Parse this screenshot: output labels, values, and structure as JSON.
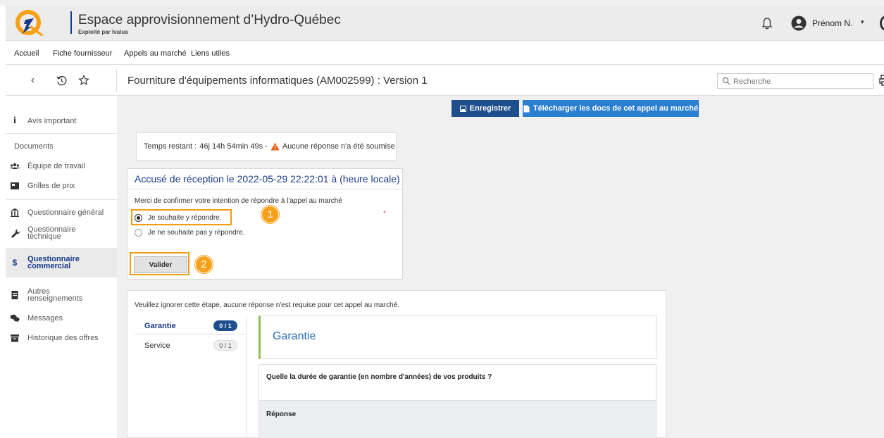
{
  "header": {
    "title": "Espace approvisionnement d’Hydro-Québec",
    "subtitle": "Exploité par Ivalua",
    "user_name": "Prénom N.",
    "caret": "▾"
  },
  "menu": {
    "items": [
      "Accueil",
      "Fiche fournisseur",
      "Appels au marché",
      "Liens utiles"
    ]
  },
  "titlebar": {
    "page_title": "Fourniture d'équipements informatiques (AM002599) : Version 1",
    "search_placeholder": "Recherche"
  },
  "sidebar": {
    "items": [
      {
        "label": "Avis important",
        "icon": "info-icon"
      },
      {
        "label": "Documents",
        "icon": ""
      },
      {
        "label": "Équipe de travail",
        "icon": "team-icon"
      },
      {
        "label": "Grilles de prix",
        "icon": "price-grid-icon"
      },
      {
        "label": "Questionnaire général",
        "icon": "institution-icon"
      },
      {
        "label": "Questionnaire technique",
        "icon": "wrench-icon"
      },
      {
        "label": "Questionnaire commercial",
        "icon": "dollar-icon"
      },
      {
        "label": "Autres renseignements",
        "icon": "document-icon"
      },
      {
        "label": "Messages",
        "icon": "chat-icon"
      },
      {
        "label": "Historique des offres",
        "icon": "archive-icon"
      }
    ],
    "commercial_line1": "Questionnaire",
    "commercial_line2": "commercial",
    "technique_line1": "Questionnaire",
    "technique_line2": "technique",
    "autres_line1": "Autres",
    "autres_line2": "renseignements"
  },
  "toolbar": {
    "save_label": "Enregistrer",
    "download_label": "Télécharger les docs de cet appel au marché"
  },
  "status": {
    "time_label": "Temps restant :",
    "time_value": "46j 14h 54min 49s -",
    "warning_text": "Aucune réponse n'a été soumise"
  },
  "ack": {
    "header": "Accusé de réception le 2022-05-29 22:22:01 à (heure locale)",
    "prompt": "Merci de confirmer votre intention de répondre à l'appel au marché",
    "required": "*",
    "option_yes": "Je souhaite y répondre.",
    "option_no": "Je ne souhaite pas y répondre.",
    "validate_label": "Valider",
    "callout_1": "1",
    "callout_2": "2"
  },
  "questionnaire": {
    "note": "Veuillez ignorer cette étape, aucune réponse n'est requise pour cet appel au marché.",
    "tabs": [
      {
        "label": "Garantie",
        "count": "0 / 1"
      },
      {
        "label": "Service",
        "count": "0 / 1"
      }
    ],
    "section_title": "Garantie",
    "question": "Quelle la durée de garantie (en nombre d'années) de vos produits ?",
    "answer_label": "Réponse"
  },
  "colors": {
    "primary": "#1f4e8c",
    "accent": "#2a7fd1",
    "highlight": "#f39c12",
    "success_bar": "#8cc152"
  }
}
